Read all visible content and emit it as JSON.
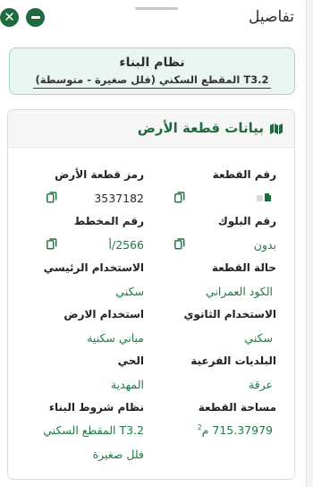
{
  "header": {
    "title": "تفاصيل",
    "close_glyph": "✕"
  },
  "building_system": {
    "title": "نظام البناء",
    "subtitle": "T3.2 المقطع السكني (فلل صغيرة - متوسطة)"
  },
  "land": {
    "title": "بيانات قطعة الأرض",
    "fields": {
      "parcel_number": {
        "label": "رقم القطعة",
        "value": ""
      },
      "parcel_code": {
        "label": "رمز قطعة الأرض",
        "value": "3537182"
      },
      "block_number": {
        "label": "رقم البلوك",
        "value": "بدون"
      },
      "plan_number": {
        "label": "رقم المخطط",
        "value": "2566/أ"
      },
      "parcel_status": {
        "label": "حالة القطعة",
        "value": "الكود العمراني"
      },
      "primary_use": {
        "label": "الاستخدام الرئيسي",
        "value": "سكني"
      },
      "secondary_use": {
        "label": "الاستخدام الثانوي",
        "value": "سكني"
      },
      "land_use": {
        "label": "استخدام الارض",
        "value": "مباني سكنية"
      },
      "sub_municipality": {
        "label": "البلديات الفرعية",
        "value": "عرقة"
      },
      "district": {
        "label": "الحي",
        "value": "المهدية"
      },
      "parcel_area": {
        "label": "مساحة القطعة",
        "value": "715.37979 م",
        "unit_sup": "2"
      },
      "building_conditions": {
        "label": "نظام شروط البناء",
        "value": "T3.2 المقطع السكني",
        "value_line2": "فلل صغيرة"
      }
    }
  },
  "colors": {
    "brand_green": "#1f6b3f",
    "value_green": "#1e7a45",
    "card_bg": "#e9f6ef",
    "card_border": "#a6d7bd"
  },
  "icons": {
    "close": "close-icon",
    "minimize": "minus-icon",
    "map": "map-icon",
    "copy": "copy-icon"
  }
}
